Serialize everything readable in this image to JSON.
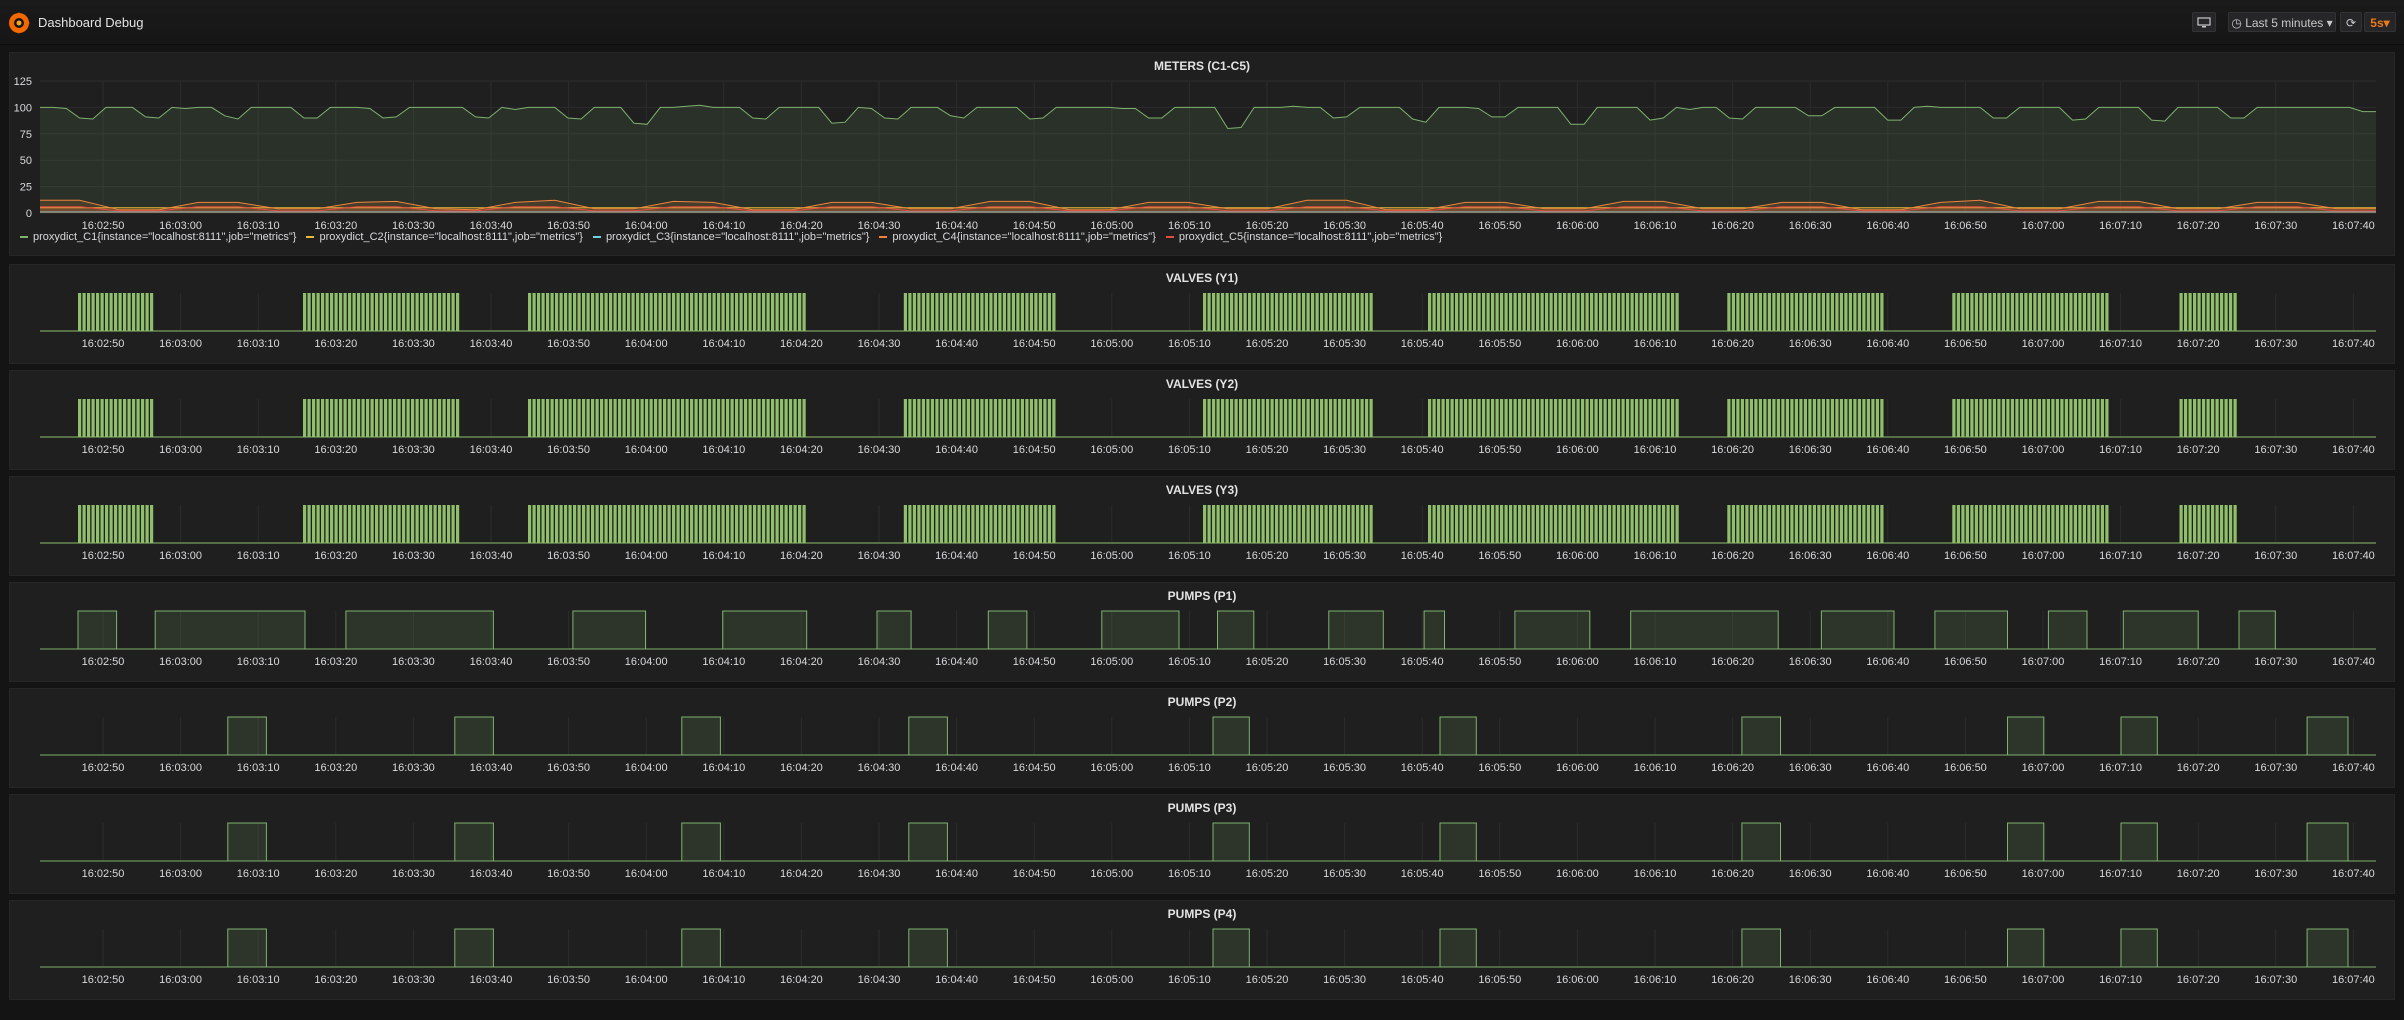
{
  "header": {
    "title": "Dashboard Debug",
    "time_range": "Last 5 minutes",
    "refresh_interval": "5s",
    "tv_icon": "monitor-icon",
    "clock_icon": "clock-icon",
    "refresh_icon": "refresh-icon"
  },
  "colors": {
    "c1": "#7eb26d",
    "c2": "#eab839",
    "c3": "#6ed0e0",
    "c4": "#ef843c",
    "c5": "#e24d42",
    "valve": "#8fbf6a",
    "pump": "#7eb26d"
  },
  "x_ticks": [
    "16:02:50",
    "16:03:00",
    "16:03:10",
    "16:03:20",
    "16:03:30",
    "16:03:40",
    "16:03:50",
    "16:04:00",
    "16:04:10",
    "16:04:20",
    "16:04:30",
    "16:04:40",
    "16:04:50",
    "16:05:00",
    "16:05:10",
    "16:05:20",
    "16:05:30",
    "16:05:40",
    "16:05:50",
    "16:06:00",
    "16:06:10",
    "16:06:20",
    "16:06:30",
    "16:06:40",
    "16:06:50",
    "16:07:00",
    "16:07:10",
    "16:07:20",
    "16:07:30",
    "16:07:40"
  ],
  "legend": [
    "proxydict_C1{instance=\"localhost:8111\",job=\"metrics\"}",
    "proxydict_C2{instance=\"localhost:8111\",job=\"metrics\"}",
    "proxydict_C3{instance=\"localhost:8111\",job=\"metrics\"}",
    "proxydict_C4{instance=\"localhost:8111\",job=\"metrics\"}",
    "proxydict_C5{instance=\"localhost:8111\",job=\"metrics\"}"
  ],
  "chart_data": [
    {
      "type": "area",
      "title": "METERS (C1-C5)",
      "yticks": [
        "0",
        "25",
        "50",
        "75",
        "100",
        "125"
      ],
      "ylim": [
        0,
        125
      ],
      "grid": true,
      "legend_position": "bottom",
      "series": [
        {
          "name": "proxydict_C1{instance=\"localhost:8111\",job=\"metrics\"}",
          "values": [
            100,
            100,
            99,
            90,
            89,
            100,
            100,
            100,
            91,
            90,
            100,
            99,
            100,
            100,
            92,
            89,
            100,
            100,
            100,
            100,
            90,
            90,
            100,
            100,
            100,
            99,
            90,
            91,
            100,
            100,
            100,
            100,
            100,
            91,
            90,
            100,
            98,
            100,
            100,
            100,
            90,
            89,
            100,
            100,
            100,
            85,
            84,
            100,
            100,
            101,
            102,
            100,
            100,
            100,
            90,
            89,
            100,
            100,
            100,
            100,
            85,
            86,
            100,
            99,
            90,
            89,
            100,
            100,
            100,
            92,
            90,
            100,
            100,
            100,
            100,
            89,
            90,
            100,
            100,
            100,
            100,
            100,
            99,
            99,
            90,
            90,
            100,
            100,
            100,
            100,
            80,
            81,
            100,
            100,
            100,
            101,
            100,
            100,
            90,
            91,
            100,
            100,
            100,
            100,
            89,
            86,
            100,
            100,
            100,
            99,
            91,
            91,
            100,
            100,
            100,
            100,
            84,
            84,
            100,
            100,
            100,
            100,
            88,
            90,
            100,
            98,
            100,
            100,
            90,
            89,
            100,
            100,
            100,
            100,
            92,
            92,
            100,
            100,
            100,
            100,
            88,
            88,
            100,
            101,
            100,
            100,
            100,
            100,
            90,
            90,
            100,
            100,
            100,
            100,
            88,
            89,
            100,
            100,
            100,
            100,
            88,
            87,
            100,
            100,
            100,
            100,
            90,
            90,
            100,
            100,
            100,
            100,
            100,
            100,
            100,
            100,
            96,
            96
          ]
        },
        {
          "name": "proxydict_C2{instance=\"localhost:8111\",job=\"metrics\"}",
          "values": [
            5,
            5,
            5,
            5,
            5,
            5,
            5,
            5,
            5,
            5,
            5,
            5,
            5,
            5,
            5,
            5,
            5,
            5,
            5,
            5,
            5,
            5,
            5,
            5,
            5,
            5,
            5,
            5,
            5,
            5
          ]
        },
        {
          "name": "proxydict_C3{instance=\"localhost:8111\",job=\"metrics\"}",
          "values": [
            1,
            1,
            1,
            1,
            1,
            1,
            1,
            1,
            1,
            1,
            1,
            1,
            1,
            1,
            1,
            1,
            1,
            1,
            1,
            1,
            1,
            1,
            1,
            1,
            1,
            1,
            1,
            1,
            1,
            1
          ]
        },
        {
          "name": "proxydict_C4{instance=\"localhost:8111\",job=\"metrics\"}",
          "values": [
            12,
            12,
            3,
            3,
            10,
            10,
            4,
            4,
            10,
            11,
            4,
            3,
            10,
            12,
            4,
            4,
            11,
            10,
            3,
            3,
            10,
            10,
            4,
            4,
            11,
            11,
            3,
            3,
            10,
            10,
            4,
            4,
            12,
            12,
            3,
            3,
            10,
            10,
            4,
            4,
            11,
            11,
            4,
            4,
            10,
            10,
            3,
            3,
            10,
            12,
            4,
            4,
            11,
            11,
            4,
            4,
            10,
            10,
            4,
            4
          ]
        },
        {
          "name": "proxydict_C5{instance=\"localhost:8111\",job=\"metrics\"}",
          "values": [
            6,
            6,
            2,
            2,
            6,
            6,
            2,
            2,
            6,
            6,
            2,
            2,
            6,
            6,
            2,
            2,
            6,
            6,
            2,
            2,
            6,
            6,
            2,
            2,
            6,
            6,
            2,
            2,
            6,
            6,
            2,
            2,
            6,
            6,
            2,
            2,
            6,
            6,
            2,
            2,
            6,
            6,
            2,
            2,
            6,
            6,
            2,
            2,
            6,
            6,
            2,
            2,
            6,
            6,
            2,
            2,
            6,
            6,
            2,
            2
          ]
        }
      ]
    },
    {
      "type": "bar",
      "title": "VALVES (Y1)",
      "segments": [
        [
          0.0,
          0.033
        ],
        [
          0.1,
          0.17
        ],
        [
          0.2,
          0.323
        ],
        [
          0.367,
          0.435
        ],
        [
          0.5,
          0.576
        ],
        [
          0.6,
          0.712
        ],
        [
          0.733,
          0.802
        ],
        [
          0.833,
          0.902
        ],
        [
          0.934,
          0.96
        ]
      ]
    },
    {
      "type": "bar",
      "title": "VALVES (Y2)",
      "segments": [
        [
          0.0,
          0.033
        ],
        [
          0.1,
          0.17
        ],
        [
          0.2,
          0.323
        ],
        [
          0.367,
          0.435
        ],
        [
          0.5,
          0.576
        ],
        [
          0.6,
          0.712
        ],
        [
          0.733,
          0.802
        ],
        [
          0.833,
          0.902
        ],
        [
          0.934,
          0.96
        ]
      ]
    },
    {
      "type": "bar",
      "title": "VALVES (Y3)",
      "segments": [
        [
          0.0,
          0.033
        ],
        [
          0.1,
          0.17
        ],
        [
          0.2,
          0.323
        ],
        [
          0.367,
          0.435
        ],
        [
          0.5,
          0.576
        ],
        [
          0.6,
          0.712
        ],
        [
          0.733,
          0.802
        ],
        [
          0.833,
          0.902
        ],
        [
          0.934,
          0.96
        ]
      ]
    },
    {
      "type": "area",
      "title": "PUMPS (P1)",
      "segments": [
        [
          0.0,
          0.017
        ],
        [
          0.034,
          0.1
        ],
        [
          0.118,
          0.183
        ],
        [
          0.218,
          0.25
        ],
        [
          0.284,
          0.321
        ],
        [
          0.352,
          0.367
        ],
        [
          0.401,
          0.418
        ],
        [
          0.451,
          0.485
        ],
        [
          0.502,
          0.518
        ],
        [
          0.551,
          0.575
        ],
        [
          0.593,
          0.602
        ],
        [
          0.633,
          0.666
        ],
        [
          0.684,
          0.749
        ],
        [
          0.768,
          0.8
        ],
        [
          0.818,
          0.85
        ],
        [
          0.868,
          0.885
        ],
        [
          0.901,
          0.934
        ],
        [
          0.952,
          0.968
        ]
      ]
    },
    {
      "type": "area",
      "title": "PUMPS (P2)",
      "segments": [
        [
          0.066,
          0.083
        ],
        [
          0.166,
          0.183
        ],
        [
          0.266,
          0.283
        ],
        [
          0.366,
          0.383
        ],
        [
          0.5,
          0.516
        ],
        [
          0.6,
          0.616
        ],
        [
          0.733,
          0.75
        ],
        [
          0.85,
          0.866
        ],
        [
          0.9,
          0.916
        ],
        [
          0.982,
          1.0
        ]
      ]
    },
    {
      "type": "area",
      "title": "PUMPS (P3)",
      "segments": [
        [
          0.066,
          0.083
        ],
        [
          0.166,
          0.183
        ],
        [
          0.266,
          0.283
        ],
        [
          0.366,
          0.383
        ],
        [
          0.5,
          0.516
        ],
        [
          0.6,
          0.616
        ],
        [
          0.733,
          0.75
        ],
        [
          0.85,
          0.866
        ],
        [
          0.9,
          0.916
        ],
        [
          0.982,
          1.0
        ]
      ]
    },
    {
      "type": "area",
      "title": "PUMPS (P4)",
      "segments": [
        [
          0.066,
          0.083
        ],
        [
          0.166,
          0.183
        ],
        [
          0.266,
          0.283
        ],
        [
          0.366,
          0.383
        ],
        [
          0.5,
          0.516
        ],
        [
          0.6,
          0.616
        ],
        [
          0.733,
          0.75
        ],
        [
          0.85,
          0.866
        ],
        [
          0.9,
          0.916
        ],
        [
          0.982,
          1.0
        ]
      ]
    }
  ]
}
